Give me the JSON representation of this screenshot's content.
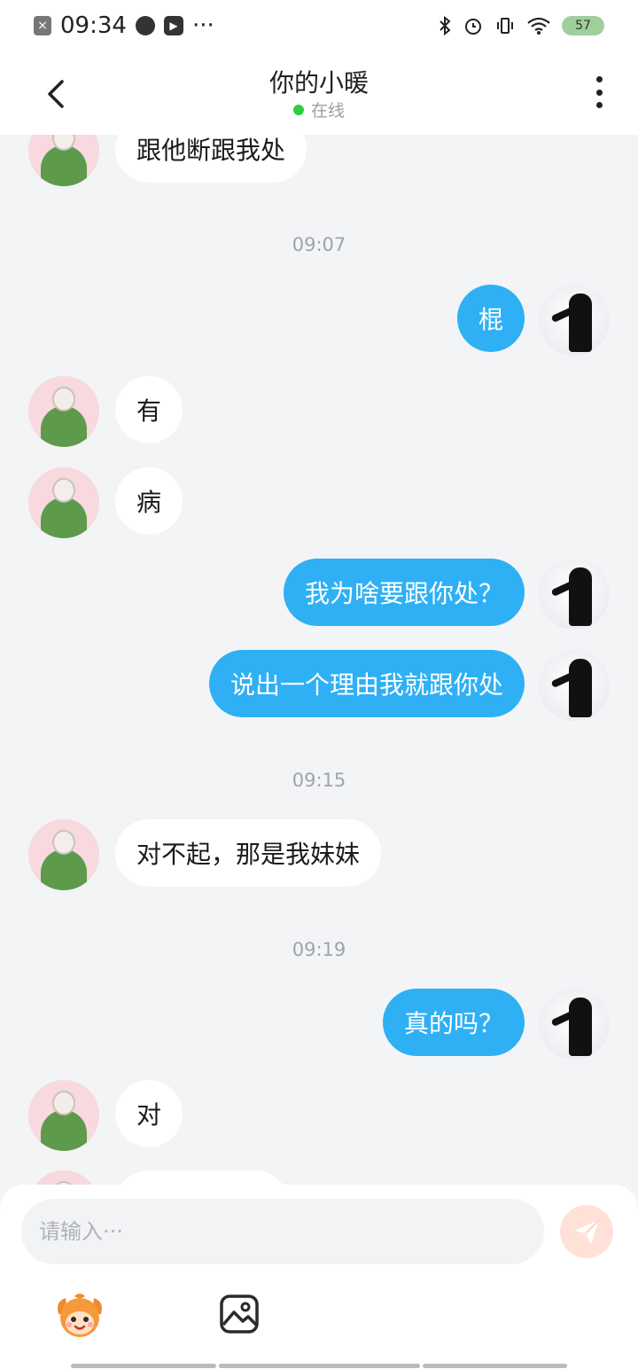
{
  "status_bar": {
    "time": "09:34",
    "dots": "···",
    "battery": "57",
    "icons": [
      "close-box-icon",
      "speed-icon",
      "play-icon",
      "bluetooth-icon",
      "alarm-icon",
      "vibrate-icon",
      "wifi-icon",
      "battery-icon"
    ]
  },
  "header": {
    "title": "你的小暖",
    "status": "在线",
    "status_color": "#2ecc40",
    "icons": [
      "back-chevron-icon",
      "more-vertical-icon"
    ]
  },
  "chat": {
    "accent_color": "#2fb0f4",
    "messages": [
      {
        "sender": "other",
        "text": "跟他断跟我处"
      },
      {
        "type": "time",
        "text": "09:07"
      },
      {
        "sender": "self",
        "text": "棍"
      },
      {
        "sender": "other",
        "text": "有"
      },
      {
        "sender": "other",
        "text": "病"
      },
      {
        "sender": "self",
        "text": "我为啥要跟你处？"
      },
      {
        "sender": "self",
        "text": "说出一个理由我就跟你处"
      },
      {
        "type": "time",
        "text": "09:15"
      },
      {
        "sender": "other",
        "text": "对不起，那是我妹妹"
      },
      {
        "type": "time",
        "text": "09:19"
      },
      {
        "sender": "self",
        "text": "真的吗？"
      },
      {
        "sender": "other",
        "text": "对"
      }
    ]
  },
  "composer": {
    "placeholder": "请输入···",
    "icons": [
      "send-icon",
      "mascot-emoji-icon",
      "image-icon"
    ]
  }
}
